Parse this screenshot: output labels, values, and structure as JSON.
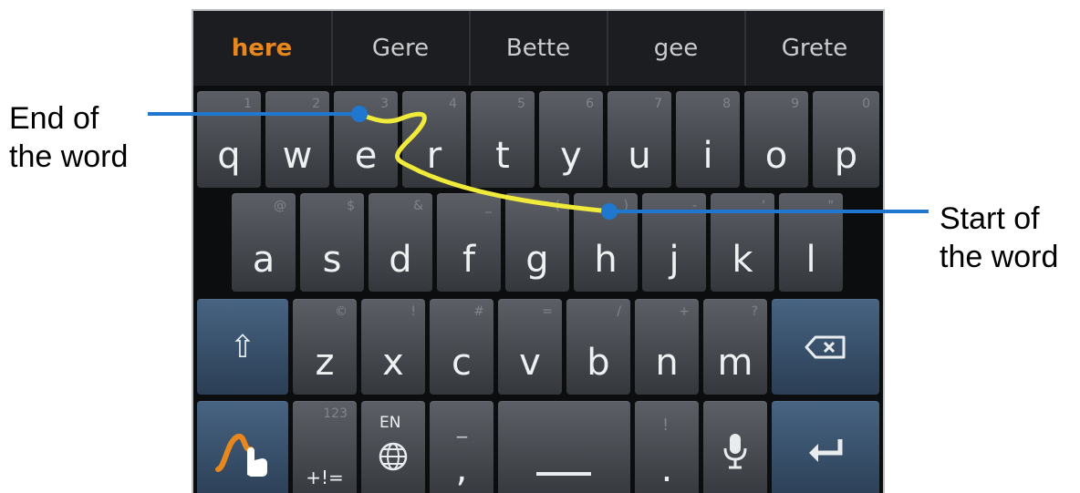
{
  "suggestions": [
    "here",
    "Gere",
    "Bette",
    "gee",
    "Grete"
  ],
  "rows": [
    [
      [
        "q",
        "1"
      ],
      [
        "w",
        "2"
      ],
      [
        "e",
        "3"
      ],
      [
        "r",
        "4"
      ],
      [
        "t",
        "5"
      ],
      [
        "y",
        "6"
      ],
      [
        "u",
        "7"
      ],
      [
        "i",
        "8"
      ],
      [
        "o",
        "9"
      ],
      [
        "p",
        "0"
      ]
    ],
    [
      [
        "a",
        "@"
      ],
      [
        "s",
        "$"
      ],
      [
        "d",
        "&"
      ],
      [
        "f",
        "_"
      ],
      [
        "g",
        "("
      ],
      [
        "h",
        ")"
      ],
      [
        "j",
        "-"
      ],
      [
        "k",
        "'"
      ],
      [
        "l",
        "\""
      ]
    ],
    [
      [
        "z",
        "©"
      ],
      [
        "x",
        "!"
      ],
      [
        "c",
        "#"
      ],
      [
        "v",
        "="
      ],
      [
        "b",
        "/"
      ],
      [
        "n",
        "+"
      ],
      [
        "m",
        "?"
      ]
    ]
  ],
  "bottom": {
    "numbers_top": "123",
    "numbers_bottom": "+!=",
    "language": "EN",
    "comma_alt": "_",
    "comma": ",",
    "period_alt": "!",
    "period": "."
  },
  "annotations": {
    "end_label_1": "End of",
    "end_label_2": "the word",
    "start_label_1": "Start of",
    "start_label_2": "the word"
  },
  "icons": {
    "shift": "shift-icon",
    "backspace": "backspace-icon",
    "gesture": "swype-gesture-icon",
    "globe": "globe-icon",
    "mic": "microphone-icon",
    "enter": "enter-icon"
  },
  "colors": {
    "trace": "#f0ea3a",
    "pointer": "#1f77d0",
    "suggestion_active": "#e8871e"
  }
}
